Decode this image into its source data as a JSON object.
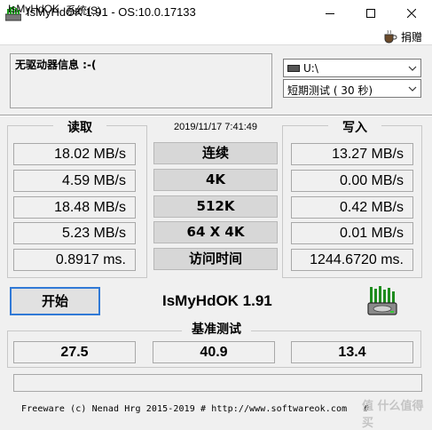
{
  "window": {
    "title": "IsMyHdOK 1.91 - OS:10.0.17133"
  },
  "menu": {
    "file": "IsMyHdOK",
    "system": "系统(S)",
    "donate": "捐赠"
  },
  "drive_info": {
    "text": "无驱动器信息 :-("
  },
  "controls": {
    "drive": "U:\\",
    "test_mode": "短期测试 ( 30 秒)"
  },
  "datetime": "2019/11/17 7:41:49",
  "read": {
    "title": "读取",
    "values": [
      "18.02 MB/s",
      "4.59 MB/s",
      "18.48 MB/s",
      "5.23 MB/s",
      "0.8917 ms."
    ]
  },
  "write": {
    "title": "写入",
    "values": [
      "13.27 MB/s",
      "0.00 MB/s",
      "0.42 MB/s",
      "0.01 MB/s",
      "1244.6720 ms."
    ]
  },
  "tests": [
    "连续",
    "4K",
    "512K",
    "64 X 4K",
    "访问时间"
  ],
  "start_label": "开始",
  "app_name": "IsMyHdOK 1.91",
  "benchmark": {
    "title": "基准测试",
    "read": "27.5",
    "total": "40.9",
    "write": "13.4"
  },
  "footer": "Freeware (c) Nenad Hrg 2015-2019 # http://www.softwareok.com   #",
  "watermark": "值 什么值得买",
  "icons": [
    "app-icon",
    "drive-icon",
    "chevron-down-icon",
    "coffee-icon",
    "hdd-logo-icon"
  ]
}
